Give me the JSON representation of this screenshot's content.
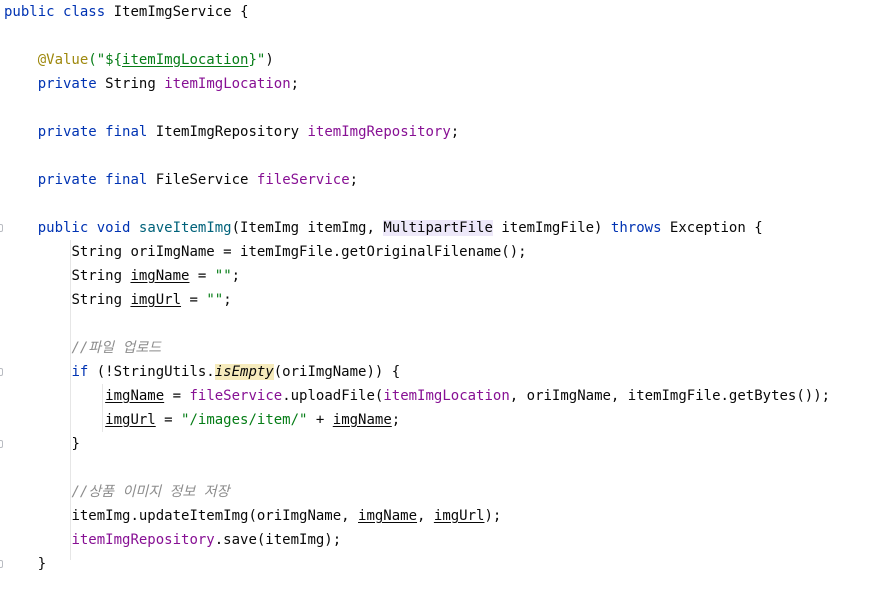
{
  "code": {
    "class_decl": {
      "kw1": "public",
      "kw2": "class",
      "name": "ItemImgService",
      "brace": "{"
    },
    "annotation": {
      "at": "@Value",
      "open": "(\"${",
      "expr": "itemImgLocation",
      "close": "}\"",
      "paren": ")"
    },
    "field_location": {
      "kw": "private",
      "type": "String",
      "name": "itemImgLocation",
      "semi": ";"
    },
    "field_repo": {
      "kw1": "private",
      "kw2": "final",
      "type": "ItemImgRepository",
      "name": "itemImgRepository",
      "semi": ";"
    },
    "field_file": {
      "kw1": "private",
      "kw2": "final",
      "type": "FileService",
      "name": "fileService",
      "semi": ";"
    },
    "method_decl": {
      "kw1": "public",
      "kw2": "void",
      "name": "saveItemImg",
      "params1": "(ItemImg itemImg, ",
      "param2_type": "MultipartFile",
      "params2": " itemImgFile) ",
      "throws": "throws",
      "exception": " Exception {"
    },
    "line_ori": "String oriImgName = itemImgFile.getOriginalFilename();",
    "line_imgname": {
      "pre": "String ",
      "var": "imgName",
      "mid": " = ",
      "str": "\"\"",
      "semi": ";"
    },
    "line_imgurl": {
      "pre": "String ",
      "var": "imgUrl",
      "mid": " = ",
      "str": "\"\"",
      "semi": ";"
    },
    "comment_upload": "//파일 업로드",
    "if_line": {
      "kw": "if",
      "pre": " (!StringUtils.",
      "call": "isEmpty",
      "post": "(oriImgName)) {"
    },
    "upload_line": {
      "var": "imgName",
      "eq": " = ",
      "field": "fileService",
      "dot": ".uploadFile(",
      "loc": "itemImgLocation",
      "rest": ", oriImgName, itemImgFile.getBytes());"
    },
    "url_line": {
      "var": "imgUrl",
      "eq": " = ",
      "str": "\"/images/item/\"",
      "plus": " + ",
      "var2": "imgName",
      "semi": ";"
    },
    "if_close": "}",
    "comment_save": "//상품 이미지 정보 저장",
    "update_line": {
      "pre": "itemImg.updateItemImg(oriImgName, ",
      "a": "imgName",
      "comma": ", ",
      "b": "imgUrl",
      "post": ");"
    },
    "save_line": {
      "field": "itemImgRepository",
      "post": ".save(itemImg);"
    },
    "method_close": "}"
  }
}
